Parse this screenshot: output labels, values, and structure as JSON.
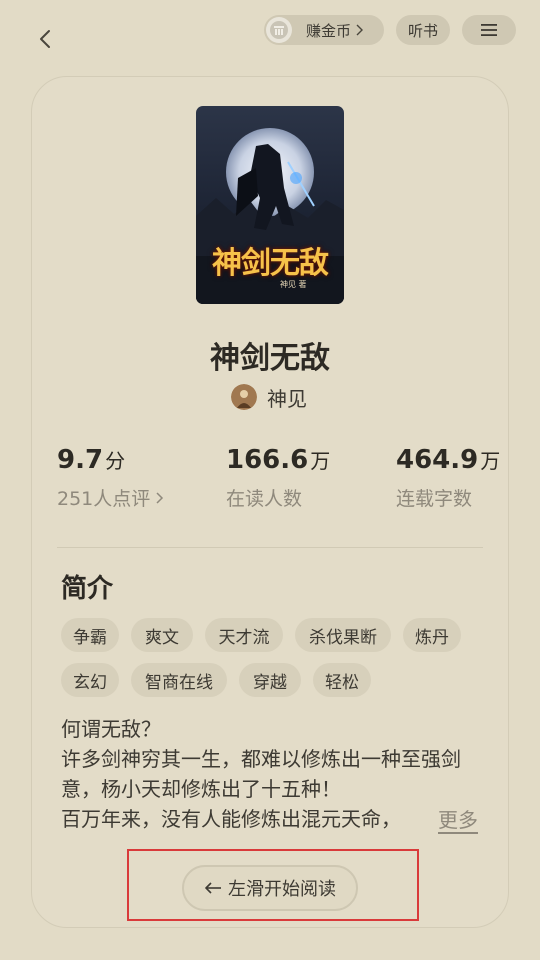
{
  "topbar": {
    "earn_coins_label": "赚金币",
    "listen_label": "听书"
  },
  "book": {
    "cover_title": "神剑无敌",
    "cover_author": "神见 著",
    "title": "神剑无敌",
    "author": "神见"
  },
  "stats": [
    {
      "value": "9.7",
      "unit": "分",
      "sub": "251人点评"
    },
    {
      "value": "166.6",
      "unit": "万",
      "sub": "在读人数"
    },
    {
      "value": "464.9",
      "unit": "万",
      "sub": "连载字数"
    }
  ],
  "intro": {
    "heading": "简介",
    "tags": [
      "争霸",
      "爽文",
      "天才流",
      "杀伐果断",
      "炼丹",
      "玄幻",
      "智商在线",
      "穿越",
      "轻松"
    ],
    "lines": [
      "何谓无敌？",
      "许多剑神穷其一生，都难以修炼出一种至强剑",
      "意，杨小天却修炼出了十五种！",
      "百万年来，没有人能修炼出混元天命，"
    ],
    "more_label": "更多"
  },
  "action": {
    "swipe_label": "左滑开始阅读"
  },
  "colors": {
    "background": "#e2dbc6",
    "card": "#e3dcc8",
    "pill": "#cfc8b3",
    "highlight": "#d93a3a"
  },
  "icons": [
    "back-chevron-icon",
    "coin-icon",
    "chevron-right-icon",
    "menu-icon",
    "arrow-left-icon"
  ]
}
